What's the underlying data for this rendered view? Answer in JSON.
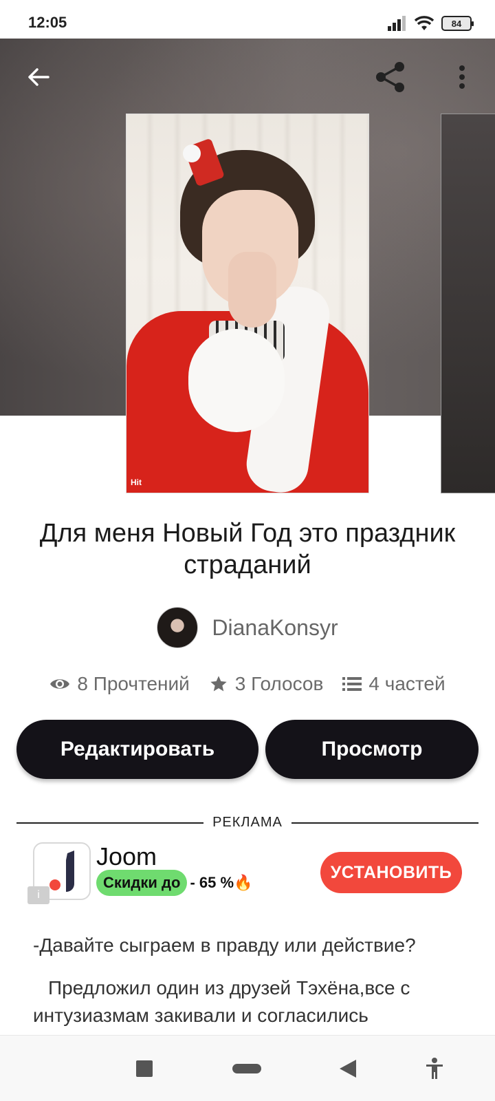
{
  "status_bar": {
    "time": "12:05",
    "battery": "84"
  },
  "story": {
    "title": "Для меня Новый Год это праздник страданий",
    "author": "DianaKonsyr",
    "stats": {
      "reads": "8 Прочтений",
      "votes": "3 Голосов",
      "parts": "4 частей"
    },
    "edit_label": "Редактировать",
    "view_label": "Просмотр",
    "text_lines": [
      "-Давайте сыграем в правду или действие?",
      "Предложил один из друзей Тэхёна,все с интузиазмам закивали и согласились"
    ]
  },
  "cover": {
    "watermark": "Hit"
  },
  "ad": {
    "label": "РЕКЛАМА",
    "brand": "Joom",
    "promo_pill": "Скидки до",
    "promo_rest": "- 65 %🔥",
    "install_label": "УСТАНОВИТЬ",
    "info_glyph": "i"
  },
  "colors": {
    "button_dark": "#141218",
    "install_red": "#f2483c",
    "promo_green": "#6fdb6f"
  }
}
